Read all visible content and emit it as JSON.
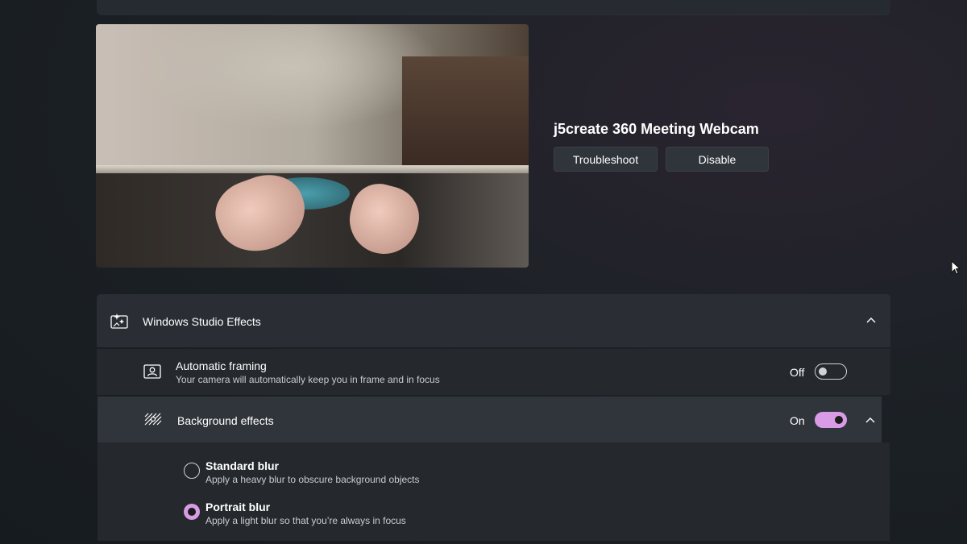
{
  "device": {
    "name": "j5create 360 Meeting Webcam",
    "troubleshoot_label": "Troubleshoot",
    "disable_label": "Disable"
  },
  "studio_effects": {
    "title": "Windows Studio Effects",
    "expanded": true,
    "icon": "sparkle-camera-icon"
  },
  "automatic_framing": {
    "title": "Automatic framing",
    "description": "Your camera will automatically keep you in frame and in focus",
    "state_label": "Off",
    "enabled": false,
    "icon": "portrait-frame-icon"
  },
  "background_effects": {
    "title": "Background effects",
    "state_label": "On",
    "enabled": true,
    "expanded": true,
    "icon": "background-blur-icon",
    "options": [
      {
        "title": "Standard blur",
        "description": "Apply a heavy blur to obscure background objects",
        "selected": false
      },
      {
        "title": "Portrait blur",
        "description": "Apply a light blur so that you’re always in focus",
        "selected": true
      }
    ]
  },
  "colors": {
    "accent": "#d99be6",
    "panel": "#2a2e34",
    "background": "#1c2126"
  }
}
